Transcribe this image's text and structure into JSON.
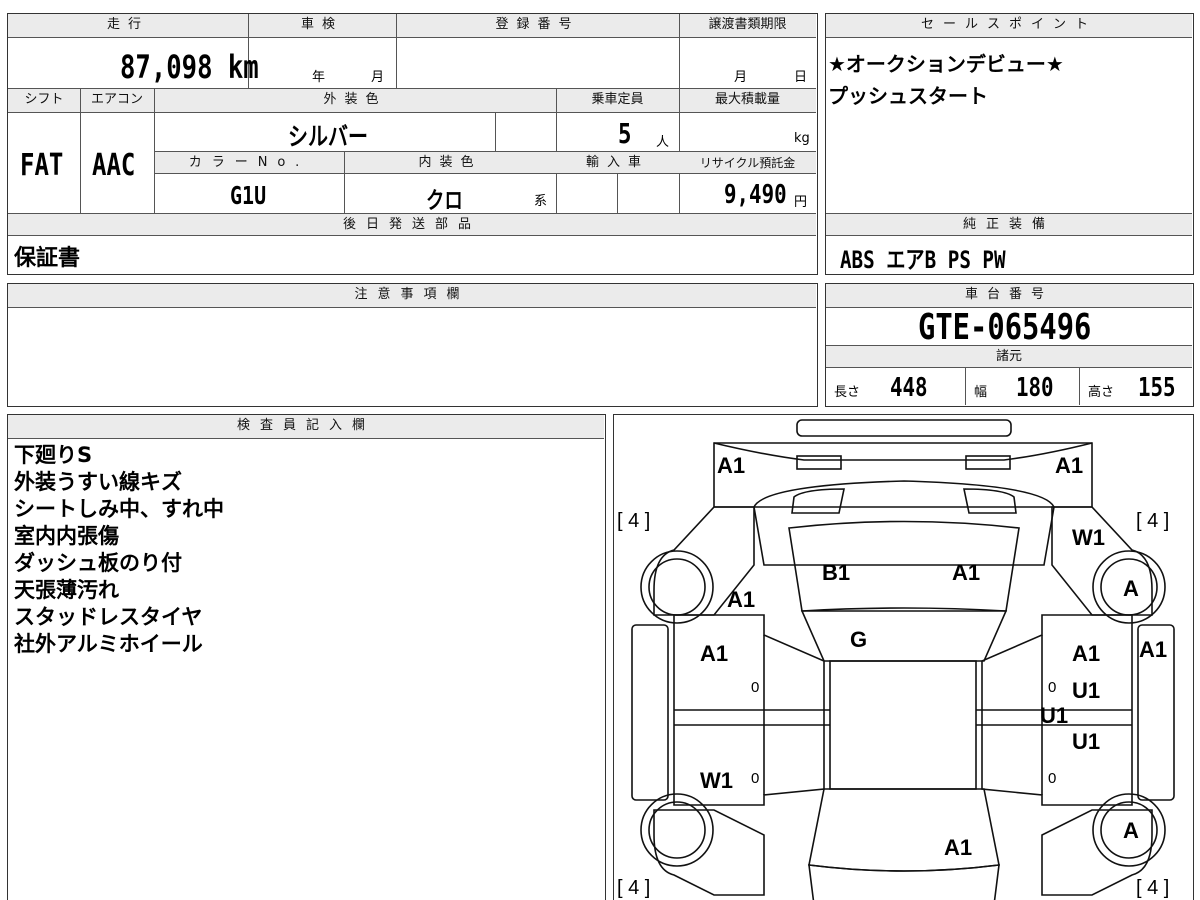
{
  "top": {
    "mileage_label": "走行",
    "mileage_value": "87,098 km",
    "inspection_label": "車検",
    "inspection_year": "年",
    "inspection_month": "月",
    "registration_label": "登録番号",
    "transfer_label": "譲渡書類期限",
    "transfer_month": "月",
    "transfer_day": "日"
  },
  "row2": {
    "shift_label": "シフト",
    "shift_value": "FAT",
    "ac_label": "エアコン",
    "ac_value": "AAC",
    "exterior_label": "外装色",
    "exterior_value": "シルバー",
    "capacity_label": "乗車定員",
    "capacity_value": "5",
    "capacity_unit": "人",
    "maxload_label": "最大積載量",
    "maxload_unit": "kg",
    "colorno_label": "カラーNo.",
    "colorno_value": "G1U",
    "interior_label": "内装色",
    "interior_value": "クロ",
    "interior_unit": "系",
    "import_label": "輸入車",
    "recycle_label": "リサイクル預託金",
    "recycle_value": "9,490",
    "recycle_unit": "円"
  },
  "later_parts": {
    "label": "後日発送部品",
    "value": "保証書"
  },
  "sales": {
    "label": "セールスポイント",
    "lines": [
      "★オークションデビュー★",
      "プッシュスタート"
    ]
  },
  "equipment": {
    "label": "純正装備",
    "value": "ABS エアB PS PW"
  },
  "caution": {
    "label": "注意事項欄"
  },
  "chassis": {
    "label": "車台番号",
    "value": "GTE-065496"
  },
  "specs": {
    "label": "諸元",
    "length_label": "長さ",
    "length_value": "448",
    "width_label": "幅",
    "width_value": "180",
    "height_label": "高さ",
    "height_value": "155"
  },
  "inspector": {
    "label": "検査員記入欄",
    "notes": [
      "下廻りS",
      "外装うすい線キズ",
      "シートしみ中、すれ中",
      "室内内張傷",
      "ダッシュ板のり付",
      "天張薄汚れ",
      "スタッドレスタイヤ",
      "社外アルミホイール"
    ]
  },
  "diagram": {
    "marks": [
      "A1",
      "A1",
      "W1",
      "B1",
      "A1",
      "A1",
      "A",
      "G",
      "A1",
      "A1",
      "A1",
      "U1",
      "U1",
      "U1",
      "W1",
      "A",
      "A1"
    ],
    "tires": [
      "[ 4 ]",
      "[ 4 ]",
      "[ 4 ]",
      "[ 4 ]"
    ],
    "zeros": [
      "0",
      "0",
      "0",
      "0"
    ]
  }
}
